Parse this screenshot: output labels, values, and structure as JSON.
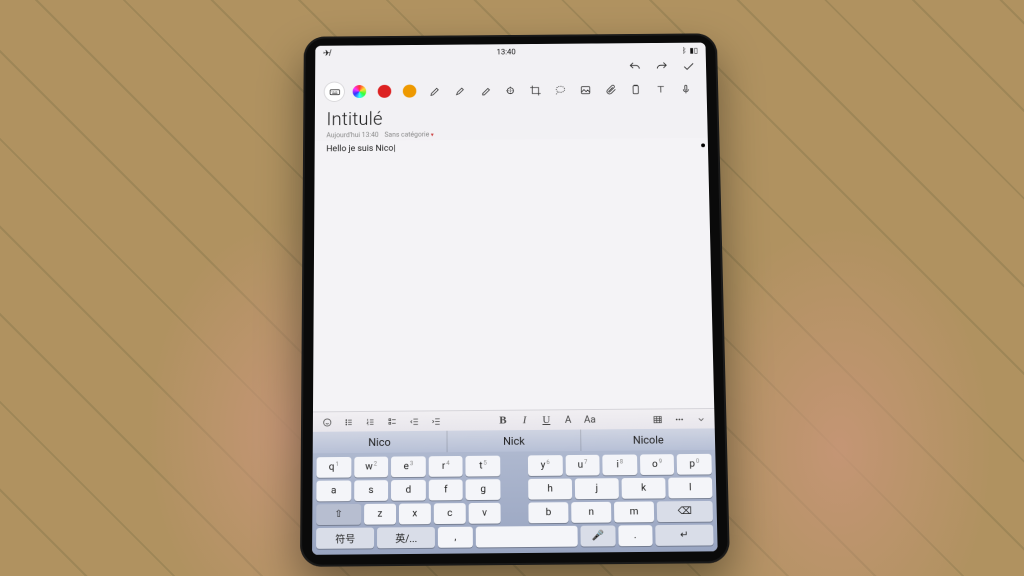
{
  "status": {
    "time": "13:40",
    "battery_icon": "battery",
    "no_network_icon": "no-network"
  },
  "actions": {
    "undo_icon": "undo",
    "redo_icon": "redo",
    "confirm_icon": "check"
  },
  "toolbar": {
    "keyboard_icon": "keyboard",
    "color_picker_icon": "palette",
    "pens": [
      "red",
      "orange"
    ],
    "tools_icons": [
      "pen",
      "highlighter",
      "eraser",
      "shape",
      "crop",
      "lasso",
      "image",
      "attachment",
      "clipboard",
      "format",
      "mic"
    ]
  },
  "note": {
    "title": "Intitulé",
    "meta_date": "Aujourd'hui 13:40",
    "meta_category": "Sans catégorie",
    "body": "Hello je suis Nico"
  },
  "formatbar": {
    "smile_icon": "emoji",
    "bullets_icon": "bullet-list",
    "numbered_icon": "numbered-list",
    "checklist_icon": "checklist",
    "outdent_icon": "outdent",
    "indent_icon": "indent",
    "bold": "B",
    "italic": "I",
    "underline": "U",
    "fontA": "A",
    "fontAa": "Aa",
    "table_icon": "table",
    "more_icon": "more",
    "collapse_icon": "collapse"
  },
  "suggestions": [
    "Nico",
    "Nick",
    "Nicole"
  ],
  "keyboard": {
    "left": {
      "r1": [
        {
          "c": "q",
          "n": "1"
        },
        {
          "c": "w",
          "n": "2"
        },
        {
          "c": "e",
          "n": "3"
        },
        {
          "c": "r",
          "n": "4"
        },
        {
          "c": "t",
          "n": "5"
        }
      ],
      "r2": [
        {
          "c": "a"
        },
        {
          "c": "s"
        },
        {
          "c": "d"
        },
        {
          "c": "f"
        },
        {
          "c": "g"
        }
      ],
      "r3_shift": "⇧",
      "r3": [
        {
          "c": "z"
        },
        {
          "c": "x"
        },
        {
          "c": "c"
        },
        {
          "c": "v"
        }
      ]
    },
    "right": {
      "r1": [
        {
          "c": "y",
          "n": "6"
        },
        {
          "c": "u",
          "n": "7"
        },
        {
          "c": "i",
          "n": "8"
        },
        {
          "c": "o",
          "n": "9"
        },
        {
          "c": "p",
          "n": "0"
        }
      ],
      "r2": [
        {
          "c": "h"
        },
        {
          "c": "j"
        },
        {
          "c": "k"
        },
        {
          "c": "l"
        }
      ],
      "r3": [
        {
          "c": "b"
        },
        {
          "c": "n"
        },
        {
          "c": "m"
        }
      ],
      "r3_back": "⌫"
    },
    "bottom": {
      "symbols": "符号",
      "lang": "英/...",
      "comma": ",",
      "space": " ",
      "mic": "🎤",
      "period": ".",
      "enter": "↵"
    }
  }
}
